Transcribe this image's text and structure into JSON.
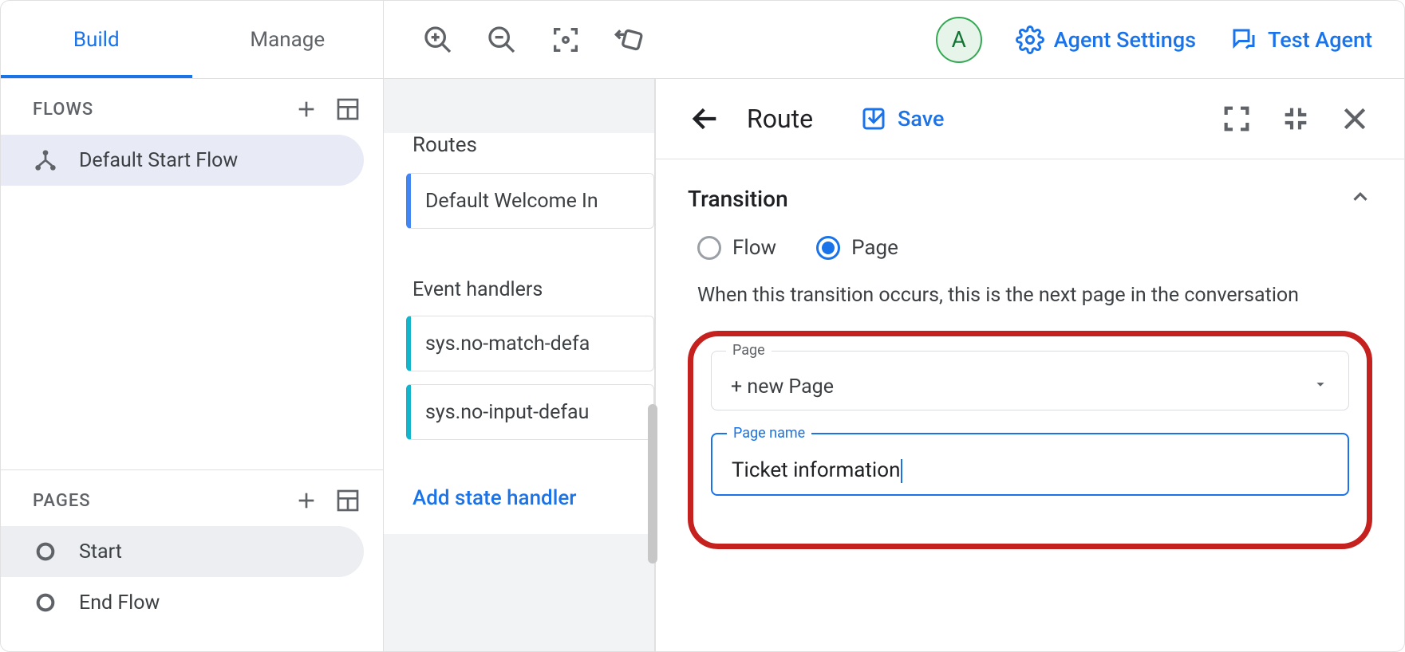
{
  "topbar": {
    "tabs": {
      "build": "Build",
      "manage": "Manage",
      "active": "build"
    },
    "avatar_initial": "A",
    "agent_settings": "Agent Settings",
    "test_agent": "Test Agent"
  },
  "sidebar": {
    "flows": {
      "header": "FLOWS",
      "items": [
        {
          "label": "Default Start Flow",
          "selected": true
        }
      ]
    },
    "pages": {
      "header": "PAGES",
      "items": [
        {
          "label": "Start",
          "selected": true
        },
        {
          "label": "End Flow",
          "selected": false
        }
      ]
    }
  },
  "midcol": {
    "routes_header": "Routes",
    "routes": [
      "Default Welcome In"
    ],
    "event_handlers_header": "Event handlers",
    "event_handlers": [
      "sys.no-match-defa",
      "sys.no-input-defau"
    ],
    "add_state_handler": "Add state handler"
  },
  "rightpanel": {
    "title": "Route",
    "save": "Save",
    "section_title": "Transition",
    "radio_flow": "Flow",
    "radio_page": "Page",
    "radio_selected": "page",
    "description": "When this transition occurs, this is the next page in the conversation",
    "page_field": {
      "label": "Page",
      "value": "+ new Page"
    },
    "page_name_field": {
      "label": "Page name",
      "value": "Ticket information"
    }
  }
}
